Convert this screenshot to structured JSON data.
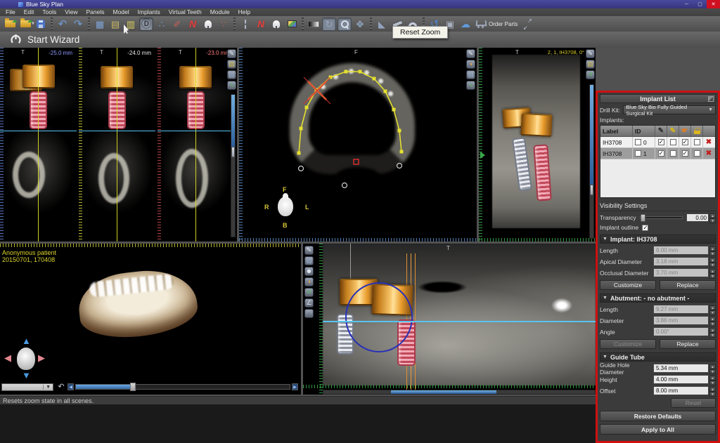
{
  "colors": {
    "highlight_border": "#cf1010",
    "slice_labels": [
      "#8f9bff",
      "#e8e8e8",
      "#ff7a7a"
    ],
    "accent_cyan": "#58c4ee",
    "accent_yellow": "#d9d920",
    "implant_pink": "#e05868",
    "crown_orange": "#f0a830"
  },
  "window": {
    "title": "Blue Sky Plan",
    "controls": {
      "minimize": "─",
      "maximize": "▢",
      "close": "✕"
    }
  },
  "menu": {
    "items": [
      "File",
      "Edit",
      "Tools",
      "View",
      "Panels",
      "Model",
      "Implants",
      "Virtual Teeth",
      "Module",
      "Help"
    ]
  },
  "toolbar": {
    "order_parts_label": "Order Parts",
    "icons": [
      {
        "name": "open-file-icon",
        "cls": "ic-folder"
      },
      {
        "name": "open-project-icon",
        "cls": "ic-folder",
        "dropdown": true
      },
      {
        "name": "save-icon",
        "cls": "ic-save"
      },
      {
        "sep": true
      },
      {
        "name": "undo-icon",
        "glyph": "↶",
        "color": "#6f9ad8",
        "size": 15
      },
      {
        "name": "redo-icon",
        "glyph": "↷",
        "color": "#6f9ad8",
        "size": 15
      },
      {
        "sep": true
      },
      {
        "name": "implant-grid-icon",
        "glyph": "▦",
        "color": "#7fa2d4"
      },
      {
        "name": "export-page-icon",
        "glyph": "▤",
        "color": "#c9b868"
      },
      {
        "name": "panel-toggle-icon",
        "glyph": "▥",
        "color": "#d8d060"
      },
      {
        "name": "reset-zoom-icon",
        "glyph": "Ⓓ",
        "color": "#20242c",
        "state": "pressed",
        "size": 14
      },
      {
        "name": "point-set-icon",
        "glyph": "∴",
        "color": "#6f9ad8"
      },
      {
        "name": "implant-pencil-icon",
        "glyph": "✐",
        "color": "#c46058"
      },
      {
        "name": "nerve-icon",
        "glyph": "N",
        "cls": "ic-nerve"
      },
      {
        "name": "add-tooth-icon",
        "cls": "ic-tooth"
      },
      {
        "name": "marked-points-icon",
        "glyph": "∵",
        "color": "#c46058"
      },
      {
        "sep": true
      },
      {
        "name": "slice-marker-icon",
        "glyph": "╏",
        "color": "#aab8c8"
      },
      {
        "name": "nerve-tool-icon",
        "glyph": "N",
        "cls": "ic-nerve"
      },
      {
        "name": "tooth-tool-icon",
        "cls": "ic-tooth"
      },
      {
        "name": "image-tools-icon",
        "cls": "ic-image"
      },
      {
        "sep": true
      },
      {
        "name": "brightness-gradient-icon",
        "cls": "ic-gradient"
      },
      {
        "name": "rotate-tool-icon",
        "glyph": "↻",
        "color": "#95a4be",
        "state": "active",
        "size": 14
      },
      {
        "name": "zoom-tool-icon",
        "cls": "ic-zoom",
        "state": "active"
      },
      {
        "name": "pan-tool-icon",
        "glyph": "✥",
        "color": "#93a8c8",
        "size": 13
      },
      {
        "sep": true
      },
      {
        "name": "profile-chart-icon",
        "glyph": "◣",
        "color": "#93a2bc"
      },
      {
        "name": "measure-ruler-icon",
        "cls": "ic-ruler"
      },
      {
        "name": "protractor-icon",
        "cls": "ic-protractor"
      },
      {
        "sep": true
      },
      {
        "name": "pan-curve-icon",
        "glyph": "↺",
        "color": "#4f84cc",
        "size": 15
      },
      {
        "name": "preferences-icon",
        "glyph": "▣",
        "color": "#a8b0c0"
      },
      {
        "name": "cloud-download-icon",
        "glyph": "☁",
        "color": "#5f9ad8",
        "size": 14
      }
    ]
  },
  "wizard": {
    "label": "Start Wizard"
  },
  "tooltip": {
    "text": "Reset Zoom"
  },
  "viewports": {
    "slices": {
      "items": [
        {
          "depth": "-25.0 mm",
          "orientation": "T"
        },
        {
          "depth": "-24.0 mm",
          "orientation": "T"
        },
        {
          "depth": "-23.0 mm",
          "orientation": "T"
        }
      ],
      "buttons": [
        {
          "name": "edit-tool-button",
          "glyph": "✎",
          "color": "#e0e6ee"
        },
        {
          "name": "contrast-button",
          "glyph": "▤",
          "color": "#d8c050"
        },
        {
          "name": "snapshot-button",
          "glyph": "▨",
          "color": "#9ab0cc"
        },
        {
          "name": "curve-tool-button",
          "glyph": "∿",
          "color": "#58b868"
        }
      ]
    },
    "axial": {
      "top_label": "F",
      "orient_front": "F",
      "orient_right": "R",
      "orient_left": "L",
      "orient_back": "B",
      "buttons": [
        {
          "name": "edit-tool-button",
          "glyph": "✎",
          "color": "#e0e6ee"
        },
        {
          "name": "palette-button",
          "glyph": "◑",
          "color": "#e0a040"
        },
        {
          "name": "snapshot-button",
          "glyph": "▨",
          "color": "#9ab0cc"
        },
        {
          "name": "curve-tool-button",
          "glyph": "∿",
          "color": "#58b868"
        }
      ]
    },
    "cross_section": {
      "orientation": "T",
      "label": "2, 1, IH3708, 0°",
      "buttons": [
        {
          "name": "edit-tool-button",
          "glyph": "✎",
          "color": "#e0e6ee"
        },
        {
          "name": "contrast-button",
          "glyph": "▤",
          "color": "#d8c050"
        },
        {
          "name": "rotate-view-button",
          "glyph": "↺",
          "color": "#58b868"
        }
      ]
    },
    "volume": {
      "patient_name": "Anonymous patient",
      "study_id": "20150701, 170408"
    },
    "panoramic": {
      "orientation": "T",
      "buttons": [
        {
          "name": "edit-tool-button",
          "glyph": "✎",
          "color": "#e0e6ee"
        },
        {
          "name": "snapshot-button",
          "glyph": "▨",
          "color": "#9ab0cc"
        },
        {
          "name": "orientation-head-button",
          "glyph": "☻",
          "color": "#e8eef6"
        },
        {
          "name": "palette-button",
          "glyph": "◑",
          "color": "#e0a040"
        },
        {
          "name": "rotate-view-button",
          "glyph": "↺",
          "color": "#58b868"
        },
        {
          "name": "ruler-button",
          "glyph": "∠",
          "color": "#d8dce4"
        },
        {
          "name": "arch-curve-button",
          "glyph": "◠",
          "color": "#9ab0cc"
        }
      ]
    }
  },
  "implant_panel": {
    "title": "Implant List",
    "drill_kit_label": "Drill Kit:",
    "drill_kit_value": "Blue Sky Bio Fully Guided Surgical Kit",
    "implants_label": "Implants:",
    "table": {
      "headers": [
        "Label",
        "ID"
      ],
      "icon_columns": [
        "pencil-icon",
        "pencil-yellow-icon",
        "hand-icon",
        "lock-icon"
      ],
      "selected_row": 1,
      "rows": [
        {
          "label": "IH3708",
          "id": "0",
          "checks": [
            false,
            true,
            false,
            true,
            false
          ]
        },
        {
          "label": "IH3708",
          "id": "1",
          "checks": [
            false,
            true,
            false,
            true,
            false
          ]
        }
      ]
    },
    "visibility": {
      "header": "Visibility Settings",
      "transparency_label": "Transparency",
      "transparency_value": "0.00",
      "outline_label": "Implant outline",
      "outline_checked": true
    },
    "implant_section": {
      "header": "Implant: IH3708",
      "fields": [
        {
          "label": "Length",
          "value": "8.00 mm"
        },
        {
          "label": "Apical Diameter",
          "value": "3.18 mm"
        },
        {
          "label": "Occlusal Diameter",
          "value": "3.70 mm"
        }
      ],
      "customize_label": "Customize",
      "replace_label": "Replace"
    },
    "abutment_section": {
      "header": "Abutment: - no abutment -",
      "fields": [
        {
          "label": "Length",
          "value": "9.27 mm"
        },
        {
          "label": "Diameter",
          "value": "3.86 mm"
        },
        {
          "label": "Angle",
          "value": "0.00°"
        }
      ],
      "customize_label": "Customize",
      "replace_label": "Replace"
    },
    "guide_tube": {
      "header": "Guide Tube",
      "fields": [
        {
          "label": "Guide Hole Diameter",
          "value": "5.34 mm"
        },
        {
          "label": "Height",
          "value": "4.00 mm"
        },
        {
          "label": "Offset",
          "value": "8.00 mm"
        }
      ],
      "reset_label": "Reset",
      "restore_label": "Restore Defaults",
      "apply_label": "Apply to All"
    }
  },
  "status_bar": {
    "text": "Resets zoom state in all scenes."
  }
}
